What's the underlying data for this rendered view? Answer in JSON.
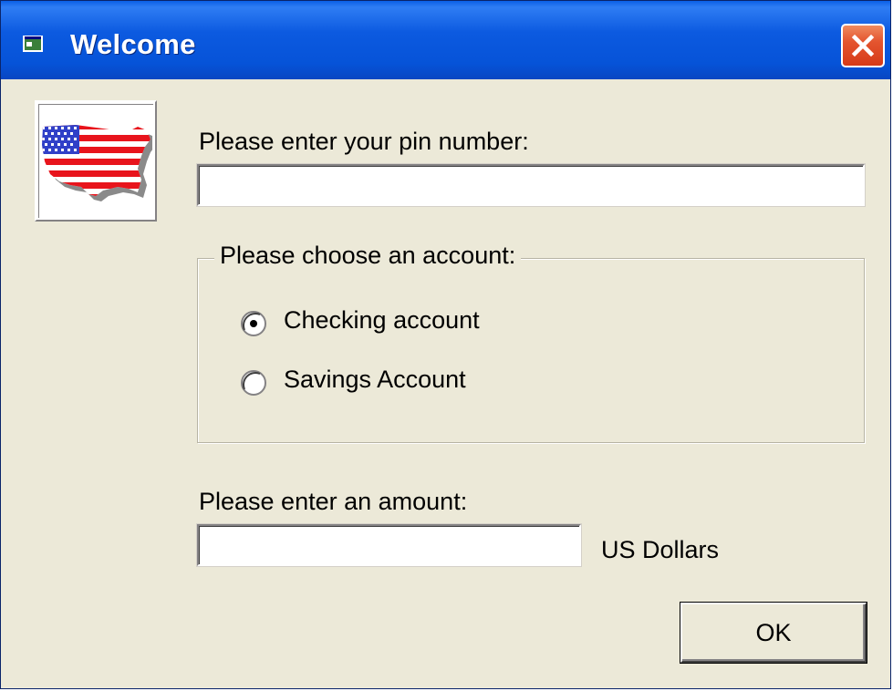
{
  "window": {
    "title": "Welcome",
    "icon": "window-icon",
    "close_icon": "close-icon"
  },
  "pin": {
    "label": "Please enter your pin number:",
    "value": "",
    "placeholder": ""
  },
  "account": {
    "legend": "Please choose an account:",
    "options": [
      {
        "label": "Checking account",
        "selected": true
      },
      {
        "label": "Savings Account",
        "selected": false
      }
    ]
  },
  "amount": {
    "label": "Please enter an amount:",
    "value": "",
    "placeholder": "",
    "unit": "US Dollars"
  },
  "ok_button": {
    "label": "OK"
  },
  "logo": {
    "icon": "us-flag-map-icon"
  },
  "colors": {
    "titlebar": "#0653d8",
    "window_bg": "#ece9d8",
    "close_button": "#e4552f"
  }
}
